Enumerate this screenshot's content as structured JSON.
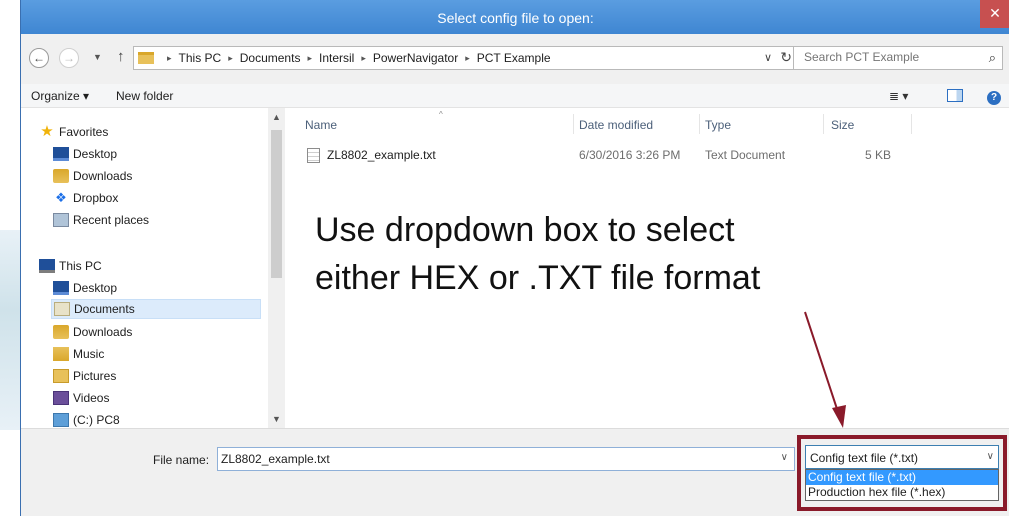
{
  "window": {
    "title": "Select config file to open:",
    "close_glyph": "✕"
  },
  "nav": {
    "back": "←",
    "forward": "→",
    "recent": "▼",
    "up": "↑"
  },
  "address": {
    "crumbs": [
      "This PC",
      "Documents",
      "Intersil",
      "PowerNavigator",
      "PCT Example"
    ],
    "sep": "▸",
    "dropdown": "∨",
    "refresh": "↻"
  },
  "search": {
    "placeholder": "Search PCT Example",
    "icon": "search-icon"
  },
  "toolbar": {
    "organize": "Organize ▾",
    "new_folder": "New folder",
    "view_menu": "≣ ▾"
  },
  "sidebar": {
    "favorites": "Favorites",
    "fav_items": [
      "Desktop",
      "Downloads",
      "Dropbox",
      "Recent places"
    ],
    "this_pc": "This PC",
    "pc_items": [
      "Desktop",
      "Documents",
      "Downloads",
      "Music",
      "Pictures",
      "Videos",
      "(C:) PC8"
    ],
    "selected": "Documents"
  },
  "columns": {
    "name": "Name",
    "date": "Date modified",
    "type": "Type",
    "size": "Size"
  },
  "files": [
    {
      "name": "ZL8802_example.txt",
      "date": "6/30/2016 3:26 PM",
      "type": "Text Document",
      "size": "5 KB"
    }
  ],
  "annotation": {
    "line1": "Use dropdown box to select",
    "line2": "either HEX or .TXT file format",
    "color": "#8a1a2a"
  },
  "filename": {
    "label": "File name:",
    "value": "ZL8802_example.txt"
  },
  "filter": {
    "selected": "Config text file (*.txt)",
    "options": [
      "Config text file (*.txt)",
      "Production hex file (*.hex)"
    ]
  }
}
